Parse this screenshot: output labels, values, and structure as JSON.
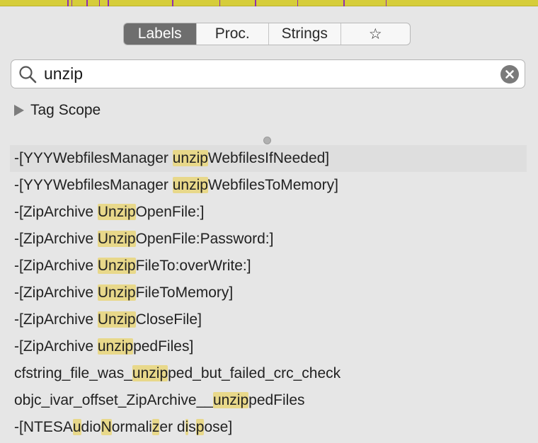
{
  "colors": {
    "top_bar": "#d6cd3a",
    "top_bar_tick": "#8f2fb0",
    "highlight": "#e8d88a",
    "active_segment": "#6e6e6e"
  },
  "tabs": [
    {
      "label": "Labels",
      "active": true
    },
    {
      "label": "Proc.",
      "active": false
    },
    {
      "label": "Strings",
      "active": false
    },
    {
      "label": "☆",
      "active": false,
      "icon": "star-icon"
    }
  ],
  "search": {
    "value": "unzip",
    "icon": "search-icon",
    "clear_icon": "clear-icon"
  },
  "scope": {
    "label": "Tag Scope",
    "expanded": false
  },
  "results": [
    {
      "parts": [
        [
          "-[YYYWebfilesManager ",
          false
        ],
        [
          "unzip",
          true
        ],
        [
          "WebfilesIfNeeded]",
          false
        ]
      ],
      "selected": true
    },
    {
      "parts": [
        [
          "-[YYYWebfilesManager ",
          false
        ],
        [
          "unzip",
          true
        ],
        [
          "WebfilesToMemory]",
          false
        ]
      ]
    },
    {
      "parts": [
        [
          "-[ZipArchive ",
          false
        ],
        [
          "Unzip",
          true
        ],
        [
          "OpenFile:]",
          false
        ]
      ]
    },
    {
      "parts": [
        [
          "-[ZipArchive ",
          false
        ],
        [
          "Unzip",
          true
        ],
        [
          "OpenFile:Password:]",
          false
        ]
      ]
    },
    {
      "parts": [
        [
          "-[ZipArchive ",
          false
        ],
        [
          "Unzip",
          true
        ],
        [
          "FileTo:overWrite:]",
          false
        ]
      ]
    },
    {
      "parts": [
        [
          "-[ZipArchive ",
          false
        ],
        [
          "Unzip",
          true
        ],
        [
          "FileToMemory]",
          false
        ]
      ]
    },
    {
      "parts": [
        [
          "-[ZipArchive ",
          false
        ],
        [
          "Unzip",
          true
        ],
        [
          "CloseFile]",
          false
        ]
      ]
    },
    {
      "parts": [
        [
          "-[ZipArchive ",
          false
        ],
        [
          "unzip",
          true
        ],
        [
          "pedFiles]",
          false
        ]
      ]
    },
    {
      "parts": [
        [
          "cfstring_file_was_",
          false
        ],
        [
          "unzip",
          true
        ],
        [
          "ped_but_failed_crc_check",
          false
        ]
      ]
    },
    {
      "parts": [
        [
          "objc_ivar_offset_ZipArchive__",
          false
        ],
        [
          "unzip",
          true
        ],
        [
          "pedFiles",
          false
        ]
      ]
    },
    {
      "parts": [
        [
          "-[NTESA",
          false
        ],
        [
          "u",
          true
        ],
        [
          "dio",
          false
        ],
        [
          "N",
          true
        ],
        [
          "ormali",
          false
        ],
        [
          "z",
          true
        ],
        [
          "er d",
          false
        ],
        [
          "i",
          true
        ],
        [
          "s",
          false
        ],
        [
          "p",
          true
        ],
        [
          "ose]",
          false
        ]
      ]
    }
  ]
}
